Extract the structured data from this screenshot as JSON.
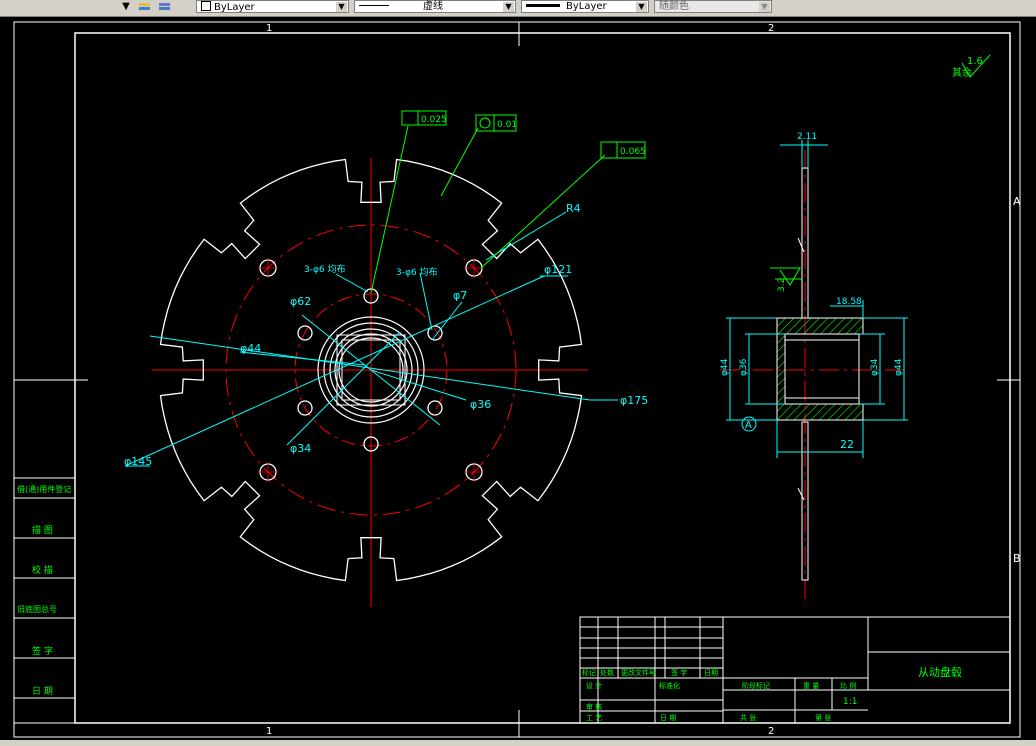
{
  "toolbar": {
    "layer_color_value": "ByLayer",
    "linetype_value": "虚线",
    "lineweight_value": "ByLayer",
    "plotstyle_value": "随颜色"
  },
  "frame": {
    "zone_top_1": "1",
    "zone_top_2": "2",
    "zone_bottom_1": "1",
    "zone_bottom_2": "2",
    "zone_right_a": "A",
    "zone_right_b": "B"
  },
  "roughness": {
    "value": "1.6",
    "label": "其余"
  },
  "tolerances": {
    "runout_1": "0.025",
    "circularity": "0.01",
    "runout_2": "0.065"
  },
  "dims_front": {
    "r4": "R4",
    "hole3a": "3-φ6 均布",
    "hole3b": "3-φ6 均布",
    "d121": "φ121",
    "d62": "φ62",
    "d7": "φ7",
    "d44": "φ44",
    "d175": "φ175",
    "d36": "φ36",
    "d145": "φ145",
    "d34": "φ34"
  },
  "dims_side": {
    "t211": "2.11",
    "h1858": "18.58",
    "rough32": "3.2",
    "d22": "22",
    "datum_a": "A",
    "dia_left1": "φ44",
    "dia_left2": "φ36",
    "dia_right1": "φ34",
    "dia_right2": "φ44"
  },
  "left_panel": {
    "r1": "借(通)用件登记",
    "r2": "描 图",
    "r3": "校 描",
    "r4": "旧底图总号",
    "r5": "签 字",
    "r6": "日 期"
  },
  "title_block": {
    "part_name": "从动盘毂",
    "scale": "1:1",
    "c_mark": "标记",
    "c_count": "处数",
    "c_file": "更改文件号",
    "c_sign": "签 字",
    "c_date": "日期",
    "c_design": "设 计",
    "c_std": "标准化",
    "c_check": "审 核",
    "c_proc": "工 艺",
    "c_dt": "日 期",
    "c_stage": "阶段标记",
    "c_weight": "重 量",
    "c_ratio": "比 例",
    "c_sheets": "共 张",
    "c_sheet": "第 张"
  },
  "colors": {
    "outline": "#ffffff",
    "center": "#ff0000",
    "dimension": "#00ffff",
    "leader": "#00ff00",
    "hatch": "#00ff00",
    "background": "#000000"
  }
}
